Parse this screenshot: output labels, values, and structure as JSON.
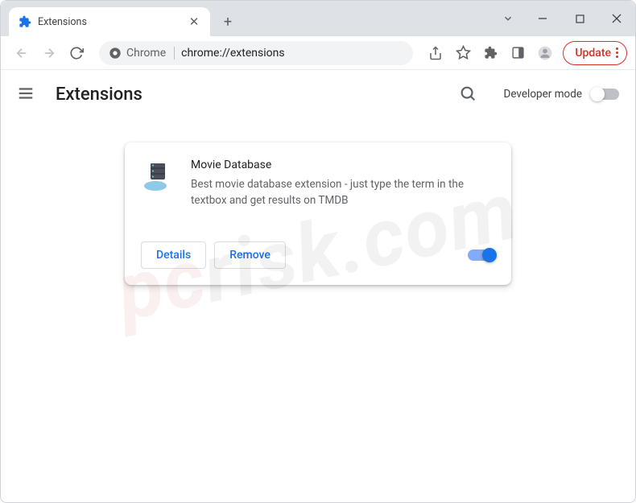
{
  "tab": {
    "title": "Extensions"
  },
  "addressBar": {
    "chip": "Chrome",
    "url": "chrome://extensions"
  },
  "updateButton": {
    "label": "Update"
  },
  "page": {
    "title": "Extensions",
    "devModeLabel": "Developer mode"
  },
  "extension": {
    "name": "Movie Database",
    "description": "Best movie database extension - just type the term in the textbox and get results on TMDB",
    "detailsLabel": "Details",
    "removeLabel": "Remove",
    "enabled": true
  },
  "icons": {
    "back": "back-icon",
    "forward": "forward-icon",
    "reload": "reload-icon",
    "share": "share-icon",
    "star": "star-icon",
    "puzzle": "puzzle-icon",
    "readingList": "reading-list-icon",
    "profile": "profile-icon",
    "search": "search-icon",
    "menu": "menu-icon",
    "close": "close-icon",
    "newTab": "new-tab-icon",
    "minimize": "minimize-icon",
    "maximize": "maximize-icon",
    "windowClose": "window-close-icon",
    "chevronDown": "chevron-down-icon"
  }
}
